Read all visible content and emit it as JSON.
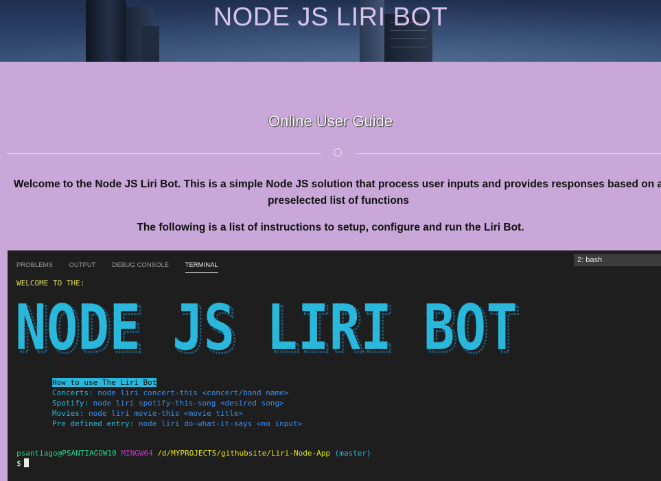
{
  "banner": {
    "title": "NODE JS LIRI BOT"
  },
  "guide": {
    "title": "Online User Guide",
    "welcome": "Welcome to the Node JS Liri Bot. This is a simple Node JS solution that process user inputs and provides responses based on a preselected list of functions",
    "instructions": "The following is a list of instructions to setup, configure and run the Liri Bot."
  },
  "terminal": {
    "tabs": [
      "PROBLEMS",
      "OUTPUT",
      "DEBUG CONSOLE",
      "TERMINAL"
    ],
    "active_tab": "TERMINAL",
    "shell_selected": "2: bash",
    "welcome_line": "WELCOME TO THE:",
    "ascii_banner": "NODE JS LIRI BOT",
    "help": {
      "title": "How to use The Liri Bot",
      "items": [
        {
          "label": "Concerts:",
          "command": "node liri concert-this <concert/band name>"
        },
        {
          "label": "Spotify:",
          "command": "node liri spotify-this-song <desired song>"
        },
        {
          "label": "Movies:",
          "command": "node liri movie-this <movie title>"
        },
        {
          "label": "Pre defined entry:",
          "command": "node liri do-what-it-says <no input>"
        }
      ]
    },
    "prompt": {
      "user": "psantiago@PSANTIAGOW10",
      "env": "MINGW64",
      "path": "/d/MYPROJECTS/githubsite/Liri-Node-App",
      "branch": "(master)",
      "symbol": "$"
    }
  },
  "colors": {
    "background": "#c9a8d9",
    "terminal_bg": "#1e1e1e",
    "ascii_cyan": "#29b8db",
    "ascii_shadow": "#1d5f86"
  }
}
